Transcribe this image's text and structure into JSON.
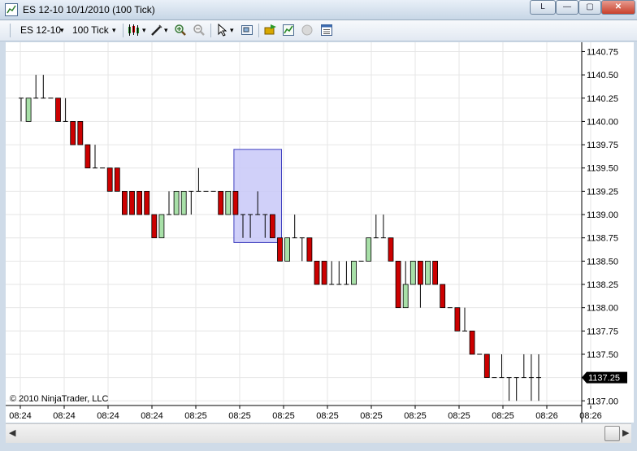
{
  "window": {
    "title": "ES 12-10  10/1/2010 (100 Tick)",
    "btn_l": "L",
    "btn_min": "—",
    "btn_max": "▢",
    "btn_close": "✕"
  },
  "toolbar": {
    "instrument": "ES 12-10",
    "interval": "100 Tick",
    "dropdown_arrow": "▾"
  },
  "chart": {
    "copyright": "© 2010 NinjaTrader, LLC"
  },
  "colors": {
    "up": "#a8e0a8",
    "down": "#cc0000",
    "selection": "#c8c8f8",
    "selection_border": "#4040c0",
    "price_tag": "#000000"
  },
  "chart_data": {
    "type": "candlestick",
    "current_price": "1137.25",
    "y_ticks": [
      "1140.75",
      "1140.50",
      "1140.25",
      "1140.00",
      "1139.75",
      "1139.50",
      "1139.25",
      "1139.00",
      "1138.75",
      "1138.50",
      "1138.25",
      "1138.00",
      "1137.75",
      "1137.50",
      "1137.25",
      "1137.00"
    ],
    "x_ticks": [
      "08:24",
      "08:24",
      "08:24",
      "08:24",
      "08:25",
      "08:25",
      "08:25",
      "08:25",
      "08:25",
      "08:25",
      "08:25",
      "08:25",
      "08:26",
      "08:26"
    ],
    "ylim": [
      1136.95,
      1140.85
    ],
    "candles": [
      [
        1140.25,
        1140.25,
        1140.0,
        1140.25
      ],
      [
        1140.0,
        1140.25,
        1140.0,
        1140.25
      ],
      [
        1140.25,
        1140.5,
        1140.25,
        1140.25
      ],
      [
        1140.25,
        1140.5,
        1140.25,
        1140.25
      ],
      [
        1140.25,
        1140.25,
        1140.25,
        1140.25
      ],
      [
        1140.25,
        1140.25,
        1140.0,
        1140.0
      ],
      [
        1140.0,
        1140.25,
        1140.0,
        1140.0
      ],
      [
        1140.0,
        1140.0,
        1139.75,
        1139.75
      ],
      [
        1140.0,
        1140.0,
        1139.75,
        1139.75
      ],
      [
        1139.75,
        1139.75,
        1139.5,
        1139.5
      ],
      [
        1139.5,
        1139.75,
        1139.5,
        1139.5
      ],
      [
        1139.5,
        1139.5,
        1139.5,
        1139.5
      ],
      [
        1139.5,
        1139.5,
        1139.25,
        1139.25
      ],
      [
        1139.5,
        1139.5,
        1139.25,
        1139.25
      ],
      [
        1139.25,
        1139.25,
        1139.0,
        1139.0
      ],
      [
        1139.25,
        1139.25,
        1139.0,
        1139.0
      ],
      [
        1139.25,
        1139.25,
        1139.0,
        1139.0
      ],
      [
        1139.25,
        1139.25,
        1139.0,
        1139.0
      ],
      [
        1139.0,
        1139.0,
        1138.75,
        1138.75
      ],
      [
        1138.75,
        1139.0,
        1138.75,
        1139.0
      ],
      [
        1139.0,
        1139.25,
        1139.0,
        1139.0
      ],
      [
        1139.0,
        1139.25,
        1139.0,
        1139.25
      ],
      [
        1139.0,
        1139.25,
        1139.0,
        1139.25
      ],
      [
        1139.25,
        1139.25,
        1139.0,
        1139.25
      ],
      [
        1139.25,
        1139.5,
        1139.25,
        1139.25
      ],
      [
        1139.25,
        1139.25,
        1139.25,
        1139.25
      ],
      [
        1139.25,
        1139.25,
        1139.25,
        1139.25
      ],
      [
        1139.25,
        1139.25,
        1139.0,
        1139.0
      ],
      [
        1139.0,
        1139.25,
        1139.0,
        1139.25
      ],
      [
        1139.25,
        1139.25,
        1139.0,
        1139.0
      ],
      [
        1139.0,
        1139.0,
        1138.75,
        1139.0
      ],
      [
        1139.0,
        1139.0,
        1138.75,
        1139.0
      ],
      [
        1139.0,
        1139.25,
        1139.0,
        1139.0
      ],
      [
        1139.0,
        1139.0,
        1138.75,
        1139.0
      ],
      [
        1139.0,
        1139.0,
        1138.75,
        1138.75
      ],
      [
        1138.75,
        1138.75,
        1138.5,
        1138.5
      ],
      [
        1138.5,
        1138.75,
        1138.5,
        1138.75
      ],
      [
        1138.75,
        1139.0,
        1138.75,
        1138.75
      ],
      [
        1138.75,
        1138.75,
        1138.5,
        1138.75
      ],
      [
        1138.75,
        1138.75,
        1138.5,
        1138.5
      ],
      [
        1138.5,
        1138.5,
        1138.25,
        1138.25
      ],
      [
        1138.5,
        1138.5,
        1138.25,
        1138.25
      ],
      [
        1138.25,
        1138.5,
        1138.25,
        1138.25
      ],
      [
        1138.25,
        1138.5,
        1138.25,
        1138.25
      ],
      [
        1138.25,
        1138.5,
        1138.25,
        1138.25
      ],
      [
        1138.25,
        1138.5,
        1138.25,
        1138.5
      ],
      [
        1138.5,
        1138.5,
        1138.5,
        1138.5
      ],
      [
        1138.5,
        1138.75,
        1138.5,
        1138.75
      ],
      [
        1138.75,
        1139.0,
        1138.75,
        1138.75
      ],
      [
        1138.75,
        1139.0,
        1138.75,
        1138.75
      ],
      [
        1138.75,
        1138.75,
        1138.5,
        1138.5
      ],
      [
        1138.5,
        1138.5,
        1138.0,
        1138.0
      ],
      [
        1138.0,
        1138.5,
        1138.0,
        1138.25
      ],
      [
        1138.25,
        1138.5,
        1138.25,
        1138.5
      ],
      [
        1138.5,
        1138.5,
        1138.0,
        1138.25
      ],
      [
        1138.25,
        1138.5,
        1138.25,
        1138.5
      ],
      [
        1138.5,
        1138.5,
        1138.25,
        1138.25
      ],
      [
        1138.25,
        1138.25,
        1138.0,
        1138.0
      ],
      [
        1138.0,
        1138.0,
        1138.0,
        1138.0
      ],
      [
        1138.0,
        1138.0,
        1137.75,
        1137.75
      ],
      [
        1137.75,
        1138.0,
        1137.75,
        1137.75
      ],
      [
        1137.75,
        1137.75,
        1137.5,
        1137.5
      ],
      [
        1137.5,
        1137.5,
        1137.5,
        1137.5
      ],
      [
        1137.5,
        1137.5,
        1137.25,
        1137.25
      ],
      [
        1137.25,
        1137.25,
        1137.25,
        1137.25
      ],
      [
        1137.25,
        1137.5,
        1137.25,
        1137.25
      ],
      [
        1137.25,
        1137.25,
        1137.0,
        1137.25
      ],
      [
        1137.25,
        1137.25,
        1137.0,
        1137.25
      ],
      [
        1137.25,
        1137.5,
        1137.25,
        1137.25
      ],
      [
        1137.25,
        1137.5,
        1137.0,
        1137.25
      ],
      [
        1137.25,
        1137.5,
        1137.0,
        1137.25
      ]
    ],
    "selection_box": {
      "from_bar": 29,
      "to_bar": 35,
      "price_high": 1139.7,
      "price_low": 1138.7
    }
  }
}
